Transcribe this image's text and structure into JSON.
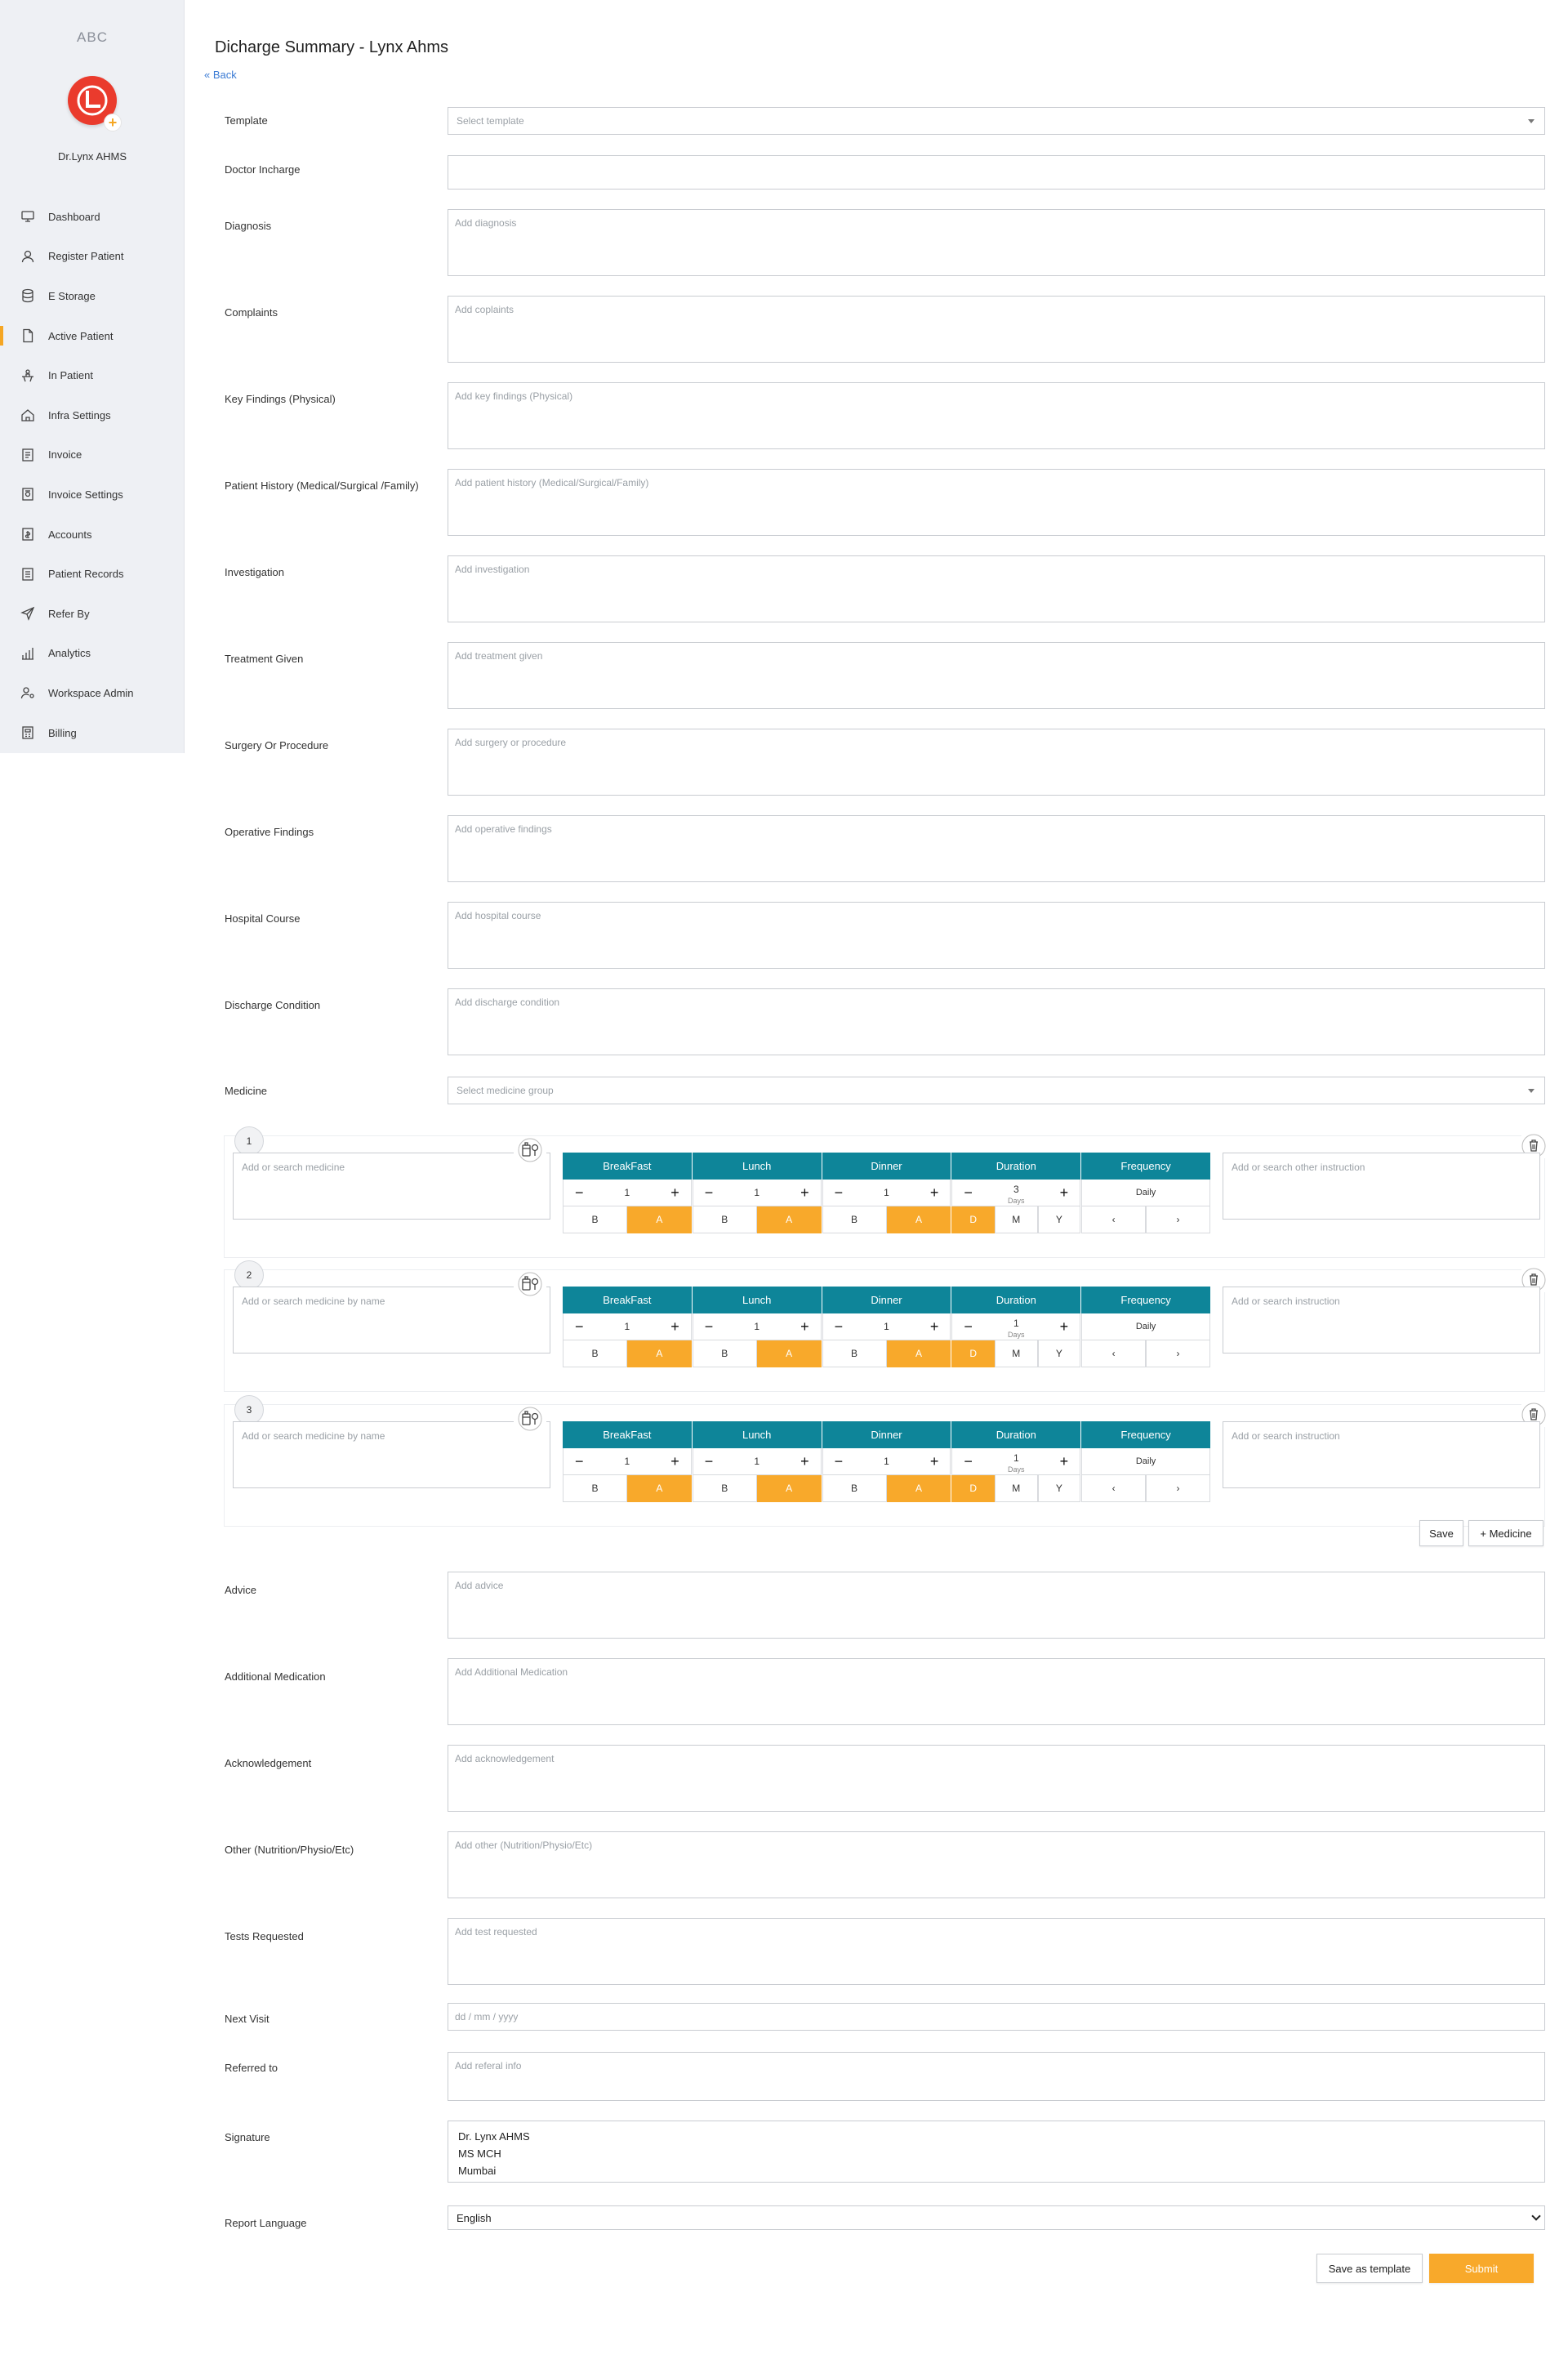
{
  "sidebar": {
    "org": "ABC",
    "user_name": "Dr.Lynx AHMS",
    "accent_color": "#f5a623",
    "items": [
      {
        "label": "Dashboard",
        "icon": "monitor-icon"
      },
      {
        "label": "Register Patient",
        "icon": "user-icon"
      },
      {
        "label": "E Storage",
        "icon": "database-icon"
      },
      {
        "label": "Active Patient",
        "icon": "file-icon",
        "active": true
      },
      {
        "label": "In Patient",
        "icon": "bed-icon"
      },
      {
        "label": "Infra Settings",
        "icon": "home-icon"
      },
      {
        "label": "Invoice",
        "icon": "invoice-icon"
      },
      {
        "label": "Invoice Settings",
        "icon": "invoice-settings-icon"
      },
      {
        "label": "Accounts",
        "icon": "accounts-icon"
      },
      {
        "label": "Patient Records",
        "icon": "records-icon"
      },
      {
        "label": "Refer By",
        "icon": "send-icon"
      },
      {
        "label": "Analytics",
        "icon": "bar-chart-icon"
      },
      {
        "label": "Workspace Admin",
        "icon": "user-gear-icon"
      },
      {
        "label": "Billing",
        "icon": "billing-icon"
      }
    ]
  },
  "header": {
    "title": "Dicharge Summary - Lynx Ahms",
    "back": "« Back"
  },
  "form": {
    "template": {
      "label": "Template",
      "placeholder": "Select template"
    },
    "doctor": {
      "label": "Doctor Incharge",
      "value": ""
    },
    "diagnosis": {
      "label": "Diagnosis",
      "placeholder": "Add diagnosis"
    },
    "complaints": {
      "label": "Complaints",
      "placeholder": "Add coplaints"
    },
    "key_findings": {
      "label": "Key Findings (Physical)",
      "placeholder": "Add key findings (Physical)"
    },
    "history": {
      "label": "Patient History (Medical/Surgical /Family)",
      "placeholder": "Add patient history (Medical/Surgical/Family)"
    },
    "investigation": {
      "label": "Investigation",
      "placeholder": "Add investigation"
    },
    "treatment": {
      "label": "Treatment Given",
      "placeholder": "Add treatment given"
    },
    "surgery": {
      "label": "Surgery Or Procedure",
      "placeholder": "Add surgery or procedure"
    },
    "operative": {
      "label": "Operative Findings",
      "placeholder": "Add operative findings"
    },
    "hospital_course": {
      "label": "Hospital Course",
      "placeholder": "Add hospital course"
    },
    "discharge_condition": {
      "label": "Discharge Condition",
      "placeholder": "Add discharge condition"
    },
    "medicine": {
      "label": "Medicine",
      "placeholder": "Select medicine group"
    },
    "advice": {
      "label": "Advice",
      "placeholder": "Add advice"
    },
    "additional_med": {
      "label": "Additional Medication",
      "placeholder": "Add Additional Medication"
    },
    "acknowledgement": {
      "label": "Acknowledgement",
      "placeholder": "Add acknowledgement"
    },
    "other": {
      "label": "Other (Nutrition/Physio/Etc)",
      "placeholder": "Add other (Nutrition/Physio/Etc)"
    },
    "tests": {
      "label": "Tests Requested",
      "placeholder": "Add test requested"
    },
    "next_visit": {
      "label": "Next Visit",
      "placeholder": "dd / mm / yyyy"
    },
    "referred": {
      "label": "Referred to",
      "placeholder": "Add referal info"
    },
    "signature": {
      "label": "Signature",
      "value": "Dr. Lynx AHMS\nMS MCH\nMumbai"
    },
    "language": {
      "label": "Report Language",
      "value": "English"
    }
  },
  "dose_headers": [
    "BreakFast",
    "Lunch",
    "Dinner",
    "Duration",
    "Frequency"
  ],
  "medicines": [
    {
      "num": "1",
      "placeholder": "Add or search medicine",
      "instr_placeholder": "Add or search other instruction",
      "breakfast": "1",
      "lunch": "1",
      "dinner": "1",
      "duration": "3",
      "duration_unit": "Days",
      "frequency": "Daily"
    },
    {
      "num": "2",
      "placeholder": "Add or search medicine by name",
      "instr_placeholder": "Add or search instruction",
      "breakfast": "1",
      "lunch": "1",
      "dinner": "1",
      "duration": "1",
      "duration_unit": "Days",
      "frequency": "Daily"
    },
    {
      "num": "3",
      "placeholder": "Add or search medicine by name",
      "instr_placeholder": "Add or search instruction",
      "breakfast": "1",
      "lunch": "1",
      "dinner": "1",
      "duration": "1",
      "duration_unit": "Days",
      "frequency": "Daily"
    }
  ],
  "dose_controls": {
    "minus": "−",
    "plus": "+",
    "before": "B",
    "after": "A",
    "day": "D",
    "month": "M",
    "year": "Y",
    "prev": "‹",
    "next": "›"
  },
  "actions": {
    "save": "Save",
    "add_medicine": "+ Medicine",
    "save_template": "Save as template",
    "submit": "Submit"
  },
  "colors": {
    "teal": "#0e8599",
    "orange": "#f8a92b",
    "avatar": "#ea3b2d"
  }
}
